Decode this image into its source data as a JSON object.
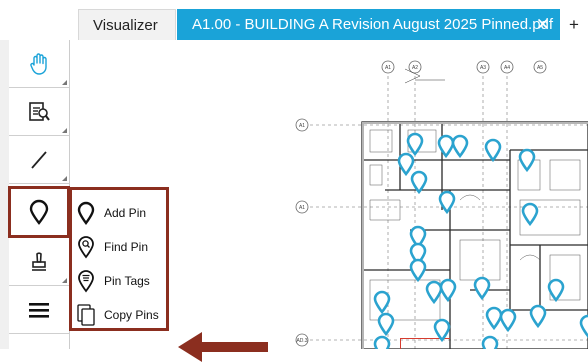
{
  "tabs": {
    "visualizer_label": "Visualizer",
    "active_file_label": "A1.00 - BUILDING A Revision August 2025 Pinned.pdf",
    "close_glyph": "✕",
    "add_glyph": "+"
  },
  "toolbar": {
    "tools": [
      {
        "name": "pan-tool",
        "icon": "hand-icon"
      },
      {
        "name": "inspect-tool",
        "icon": "document-search-icon"
      },
      {
        "name": "line-tool",
        "icon": "line-icon"
      },
      {
        "name": "pin-tool",
        "icon": "map-pin-icon",
        "active": true
      },
      {
        "name": "stamp-tool",
        "icon": "stamp-icon"
      },
      {
        "name": "menu-tool",
        "icon": "hamburger-icon"
      }
    ]
  },
  "pin_menu": {
    "items": [
      {
        "label": "Add Pin",
        "icon": "map-pin-icon"
      },
      {
        "label": "Find Pin",
        "icon": "pin-search-icon"
      },
      {
        "label": "Pin Tags",
        "icon": "pin-tags-icon"
      },
      {
        "label": "Copy Pins",
        "icon": "copy-icon"
      }
    ]
  },
  "drawing": {
    "gridline_labels": [
      "A1",
      "A2",
      "A3",
      "A4",
      "A5",
      "AD.3",
      "A1",
      "A1",
      "A2",
      "A4"
    ]
  },
  "colors": {
    "accent": "#1aa3d8",
    "highlight": "#8b2e1f",
    "pin": "#2ba3cf"
  }
}
